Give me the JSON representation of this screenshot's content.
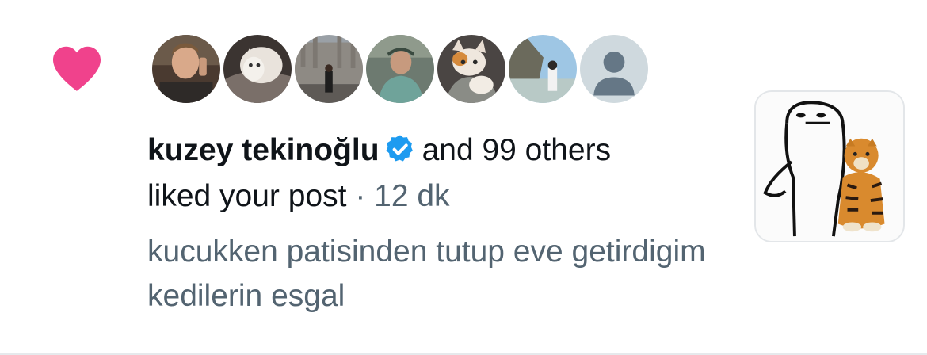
{
  "notification": {
    "type_icon": "heart-icon",
    "accent_color": "#f91880",
    "verified_color": "#1d9bf0",
    "avatars": [
      {
        "icon": "avatar-man-on-phone"
      },
      {
        "icon": "avatar-cat-on-blanket"
      },
      {
        "icon": "avatar-woman-cathedral"
      },
      {
        "icon": "avatar-man-cap"
      },
      {
        "icon": "avatar-cat-held"
      },
      {
        "icon": "avatar-woman-beach"
      },
      {
        "icon": "avatar-default-placeholder"
      }
    ],
    "user_name": "kuzey tekinoğlu",
    "others_text": "and 99 others",
    "action_text": "liked your post",
    "separator": "·",
    "time_ago": "12 dk",
    "post_preview": "kucukken patisinden tutup eve getirdigim kedilerin esgal",
    "thumbnail_icon": "meme-character-with-tiger"
  }
}
